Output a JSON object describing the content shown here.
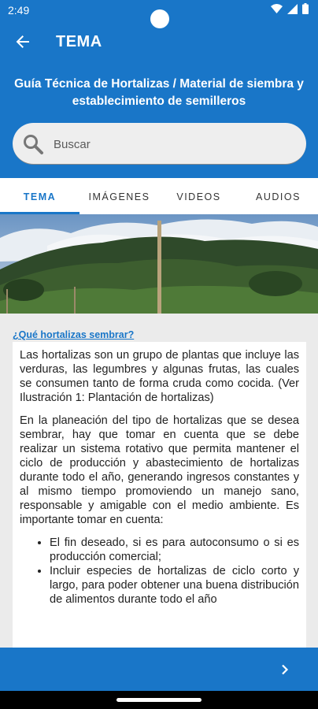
{
  "status": {
    "time": "2:49"
  },
  "app_bar": {
    "title": "TEMA",
    "back_icon": "arrow-back-icon"
  },
  "guide_title": "Guía Técnica de Hortalizas / Material de siembra y establecimiento de semilleros",
  "search": {
    "placeholder": "Buscar",
    "value": ""
  },
  "tabs": [
    {
      "label": "TEMA",
      "active": true
    },
    {
      "label": "IMÁGENES",
      "active": false
    },
    {
      "label": "VIDEOS",
      "active": false
    },
    {
      "label": "AUDIOS",
      "active": false
    }
  ],
  "content": {
    "heading": "¿Qué hortalizas sembrar?",
    "paragraphs": [
      "Las hortalizas son un grupo de plantas que incluye las verduras, las legumbres y algunas frutas, las cuales se consumen tanto de forma cruda como cocida. (Ver Ilustración 1: Plantación de hortalizas)",
      "En la planeación del tipo de hortalizas que se desea sembrar, hay que tomar en cuenta que se debe realizar un sistema rotativo que permita mantener el ciclo de producción y abastecimiento de hortalizas durante todo el año, generando ingresos constantes y al mismo tiempo promoviendo un manejo sano, responsable y amigable con el medio ambiente. Es importante tomar en cuenta:"
    ],
    "bullets": [
      "El fin deseado, si es para autoconsumo o si es producción comercial;",
      "Incluir especies de hortalizas de ciclo corto y largo, para poder obtener una buena distribución de alimentos durante todo el año"
    ]
  },
  "bottom_bar": {
    "next_icon": "chevron-right-icon"
  },
  "colors": {
    "primary": "#1976c8",
    "background": "#ebebeb"
  }
}
